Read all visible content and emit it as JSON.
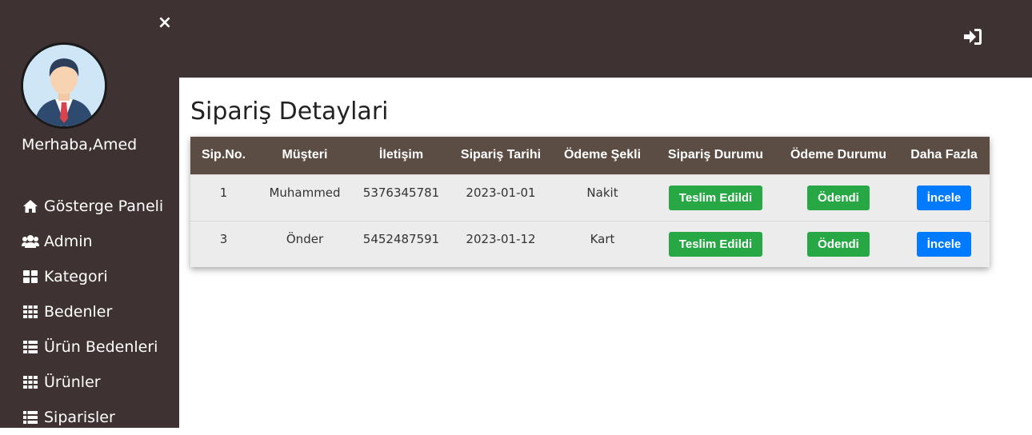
{
  "sidebar": {
    "close_label": "×",
    "greeting": "Merhaba,Amed",
    "items": [
      {
        "label": "Gösterge Paneli",
        "icon": "home-icon"
      },
      {
        "label": "Admin",
        "icon": "users-icon"
      },
      {
        "label": "Kategori",
        "icon": "th-large-icon"
      },
      {
        "label": "Bedenler",
        "icon": "th-icon"
      },
      {
        "label": "Ürün Bedenleri",
        "icon": "th-list-icon"
      },
      {
        "label": "Ürünler",
        "icon": "th-icon"
      },
      {
        "label": "Siparisler",
        "icon": "list-icon"
      }
    ]
  },
  "header": {
    "login_icon": "sign-in-icon"
  },
  "main": {
    "title": "Sipariş Detaylari",
    "columns": [
      "Sip.No.",
      "Müşteri",
      "İletişim",
      "Sipariş Tarihi",
      "Ödeme Şekli",
      "Sipariş Durumu",
      "Ödeme Durumu",
      "Daha Fazla"
    ],
    "rows": [
      {
        "no": "1",
        "customer": "Muhammed",
        "contact": "5376345781",
        "date": "2023-01-01",
        "payment_method": "Nakit",
        "order_status": "Teslim Edildi",
        "payment_status": "Ödendi",
        "action": "İncele"
      },
      {
        "no": "3",
        "customer": "Önder",
        "contact": "5452487591",
        "date": "2023-01-12",
        "payment_method": "Kart",
        "order_status": "Teslim Edildi",
        "payment_status": "Ödendi",
        "action": "İncele"
      }
    ]
  },
  "colors": {
    "sidebar_bg": "#3e3232",
    "table_header_bg": "#5c4d44",
    "success": "#28a745",
    "primary": "#007bff"
  }
}
